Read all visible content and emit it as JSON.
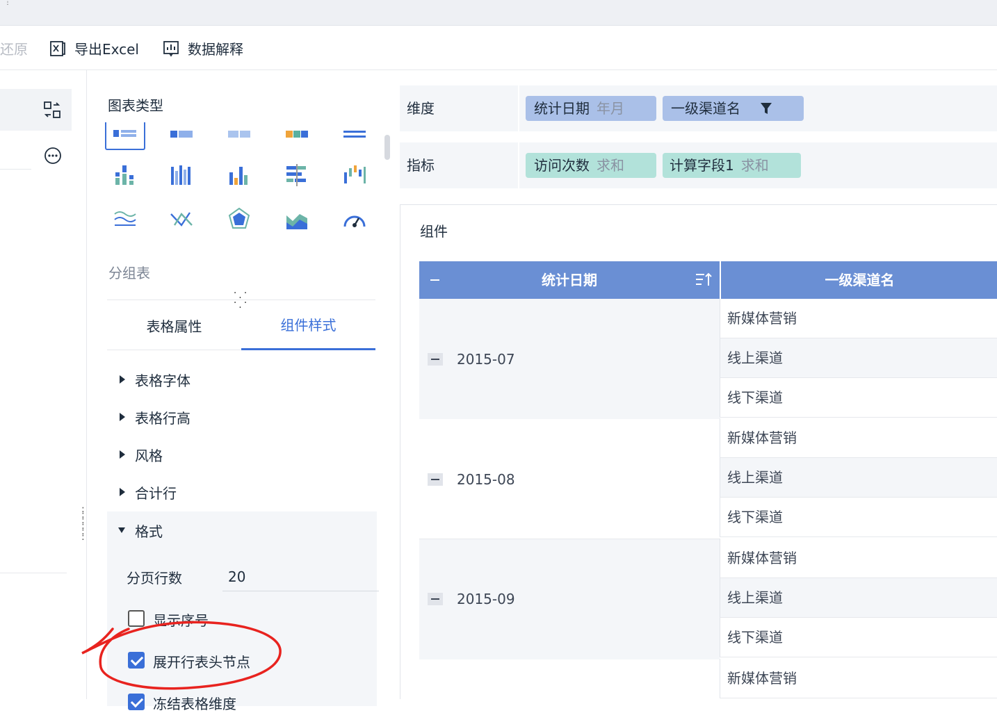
{
  "toolbar": {
    "restore_label": "还原",
    "export_label": "导出Excel",
    "explain_label": "数据解释"
  },
  "config": {
    "chart_type_title": "图表类型",
    "current_chart_name": "分组表",
    "tabs": [
      {
        "label": "表格属性"
      },
      {
        "label": "组件样式"
      }
    ],
    "style_sections": [
      {
        "label": "表格字体"
      },
      {
        "label": "表格行高"
      },
      {
        "label": "风格"
      },
      {
        "label": "合计行"
      }
    ],
    "format": {
      "title": "格式",
      "page_rows_label": "分页行数",
      "page_rows_value": "20",
      "show_index_label": "显示序号",
      "show_index_checked": false,
      "expand_header_label": "展开行表头节点",
      "expand_header_checked": true,
      "partial_label": "冻结表格维度"
    }
  },
  "fields": {
    "dimension_label": "维度",
    "dimensions": [
      {
        "name": "统计日期",
        "sub": "年月"
      },
      {
        "name": "一级渠道名",
        "sub": ""
      }
    ],
    "measure_label": "指标",
    "measures": [
      {
        "name": "访问次数",
        "sub": "求和"
      },
      {
        "name": "计算字段1",
        "sub": "求和"
      }
    ]
  },
  "widget": {
    "title": "组件",
    "columns": [
      "统计日期",
      "一级渠道名"
    ],
    "groups": [
      {
        "date": "2015-07",
        "channels": [
          "新媒体营销",
          "线上渠道",
          "线下渠道"
        ]
      },
      {
        "date": "2015-08",
        "channels": [
          "新媒体营销",
          "线上渠道",
          "线下渠道"
        ]
      },
      {
        "date": "2015-09",
        "channels": [
          "新媒体营销",
          "线上渠道",
          "线下渠道"
        ]
      },
      {
        "date": "",
        "channels": [
          "新媒体营销"
        ]
      }
    ]
  },
  "colors": {
    "accent": "#3a6fd8",
    "header_bg": "#6a8fd4",
    "dimension_pill": "#aac0e8",
    "measure_pill": "#b2e2da",
    "annotation": "#e8231f"
  }
}
